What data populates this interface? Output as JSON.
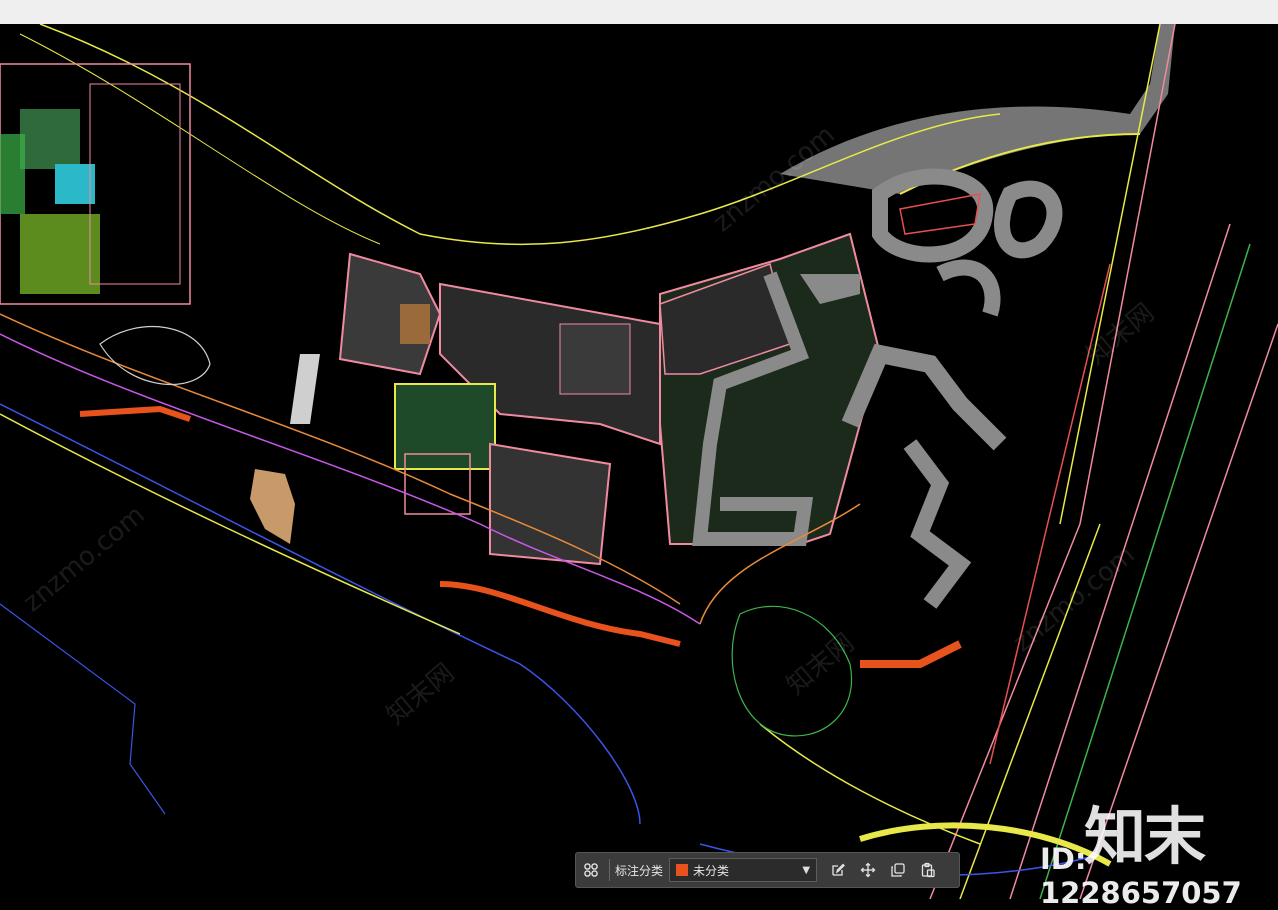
{
  "watermark": {
    "logo_text": "知末",
    "id_text": "ID: 1228657057",
    "tiled_texts": [
      "znzmo.com",
      "知末网"
    ]
  },
  "toolbar": {
    "group_icon": "grid-group-icon",
    "label": "标注分类",
    "select_value": "未分类",
    "select_swatch_color": "#e8521c",
    "tools": [
      {
        "name": "edit-icon"
      },
      {
        "name": "move-icon"
      },
      {
        "name": "copy-icon"
      },
      {
        "name": "paste-icon"
      }
    ]
  },
  "colors": {
    "background": "#000000",
    "cad_yellow": "#e8e84a",
    "cad_pink": "#f08aa0",
    "cad_gray": "#8a8a8a",
    "cad_orange": "#e8521c",
    "cad_blue": "#3a55e8",
    "cad_green": "#3cb44a"
  }
}
